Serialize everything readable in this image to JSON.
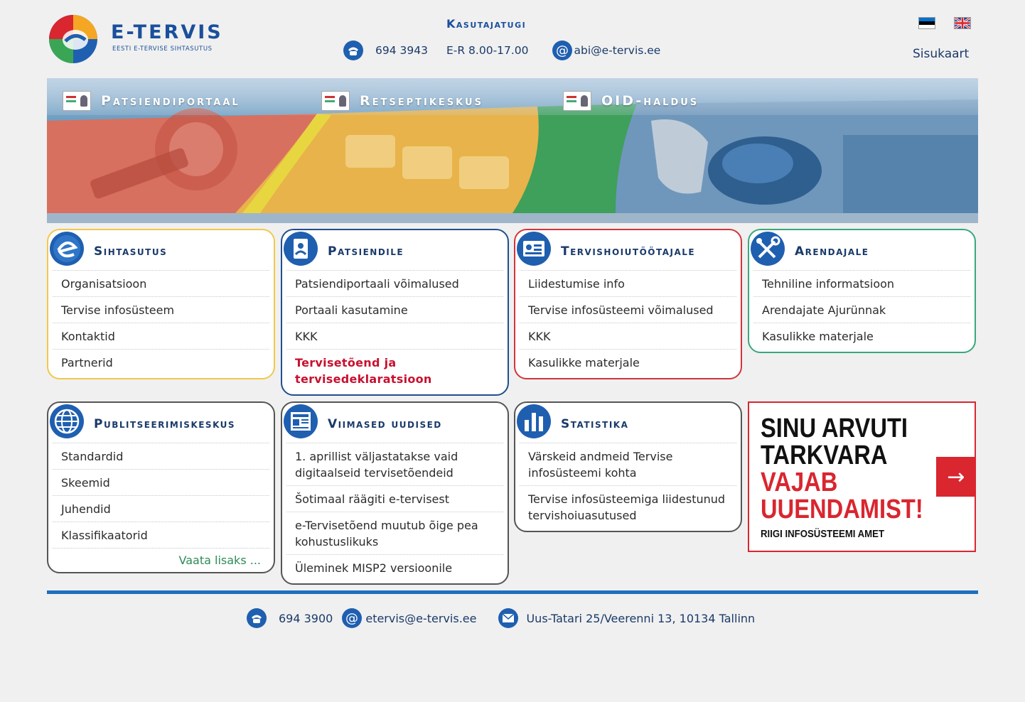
{
  "header": {
    "logo_name": "E-TERVIS",
    "logo_sub": "EESTI E-TERVISE SIHTASUTUS",
    "support_title": "Kasutajatugi",
    "support_phone": "694 3943",
    "support_hours": "E-R 8.00-17.00",
    "support_email": "abi@e-tervis.ee",
    "sitemap": "Sisukaart"
  },
  "banner": {
    "tabs": [
      "Patsiendiportaal",
      "Retseptikeskus",
      "OID-haldus"
    ]
  },
  "panels": {
    "sihtasutus": {
      "title": "Sihtasutus",
      "items": [
        "Organisatsioon",
        "Tervise infosüsteem",
        "Kontaktid",
        "Partnerid"
      ]
    },
    "patsiendile": {
      "title": "Patsiendile",
      "items": [
        "Patsiendiportaali võimalused",
        "Portaali kasutamine",
        "KKK",
        "Tervisetõend ja tervisedeklaratsioon"
      ]
    },
    "tervishoiutootajale": {
      "title": "Tervishoiutöötajale",
      "items": [
        "Liidestumise info",
        "Tervise infosüsteemi võimalused",
        "KKK",
        "Kasulikke materjale"
      ]
    },
    "arendajale": {
      "title": "Arendajale",
      "items": [
        "Tehniline informatsioon",
        "Arendajate Ajurünnak",
        "Kasulikke materjale"
      ]
    },
    "publitseerimiskeskus": {
      "title": "Publitseerimiskeskus",
      "items": [
        "Standardid",
        "Skeemid",
        "Juhendid",
        "Klassifikaatorid"
      ],
      "more": "Vaata lisaks ..."
    },
    "uudised": {
      "title": "Viimased uudised",
      "items": [
        "1. aprillist väljastatakse vaid digitaalseid tervisetõendeid",
        "Šotimaal räägiti e-tervisest",
        "e-Tervisetõend muutub õige pea kohustuslikuks",
        "Üleminek MISP2 versioonile"
      ]
    },
    "statistika": {
      "title": "Statistika",
      "items": [
        "Värskeid andmeid Tervise infosüsteemi kohta",
        "Tervise infosüsteemiga liidestunud tervishoiuasutused"
      ]
    }
  },
  "ad": {
    "line1": "SINU ARVUTI",
    "line2": "TARKVARA",
    "line3": "VAJAB",
    "line4": "UUENDAMIST!",
    "source": "RIIGI INFOSÜSTEEMI AMET",
    "arrow": "→"
  },
  "footer": {
    "phone": "694 3900",
    "email": "etervis@e-tervis.ee",
    "address": "Uus-Tatari 25/Veerenni 13, 10134 Tallinn"
  },
  "colors": {
    "brand_blue": "#1a4f9c",
    "accent_red": "#d9262f",
    "yellow": "#f1c84b",
    "green": "#39a87c"
  }
}
